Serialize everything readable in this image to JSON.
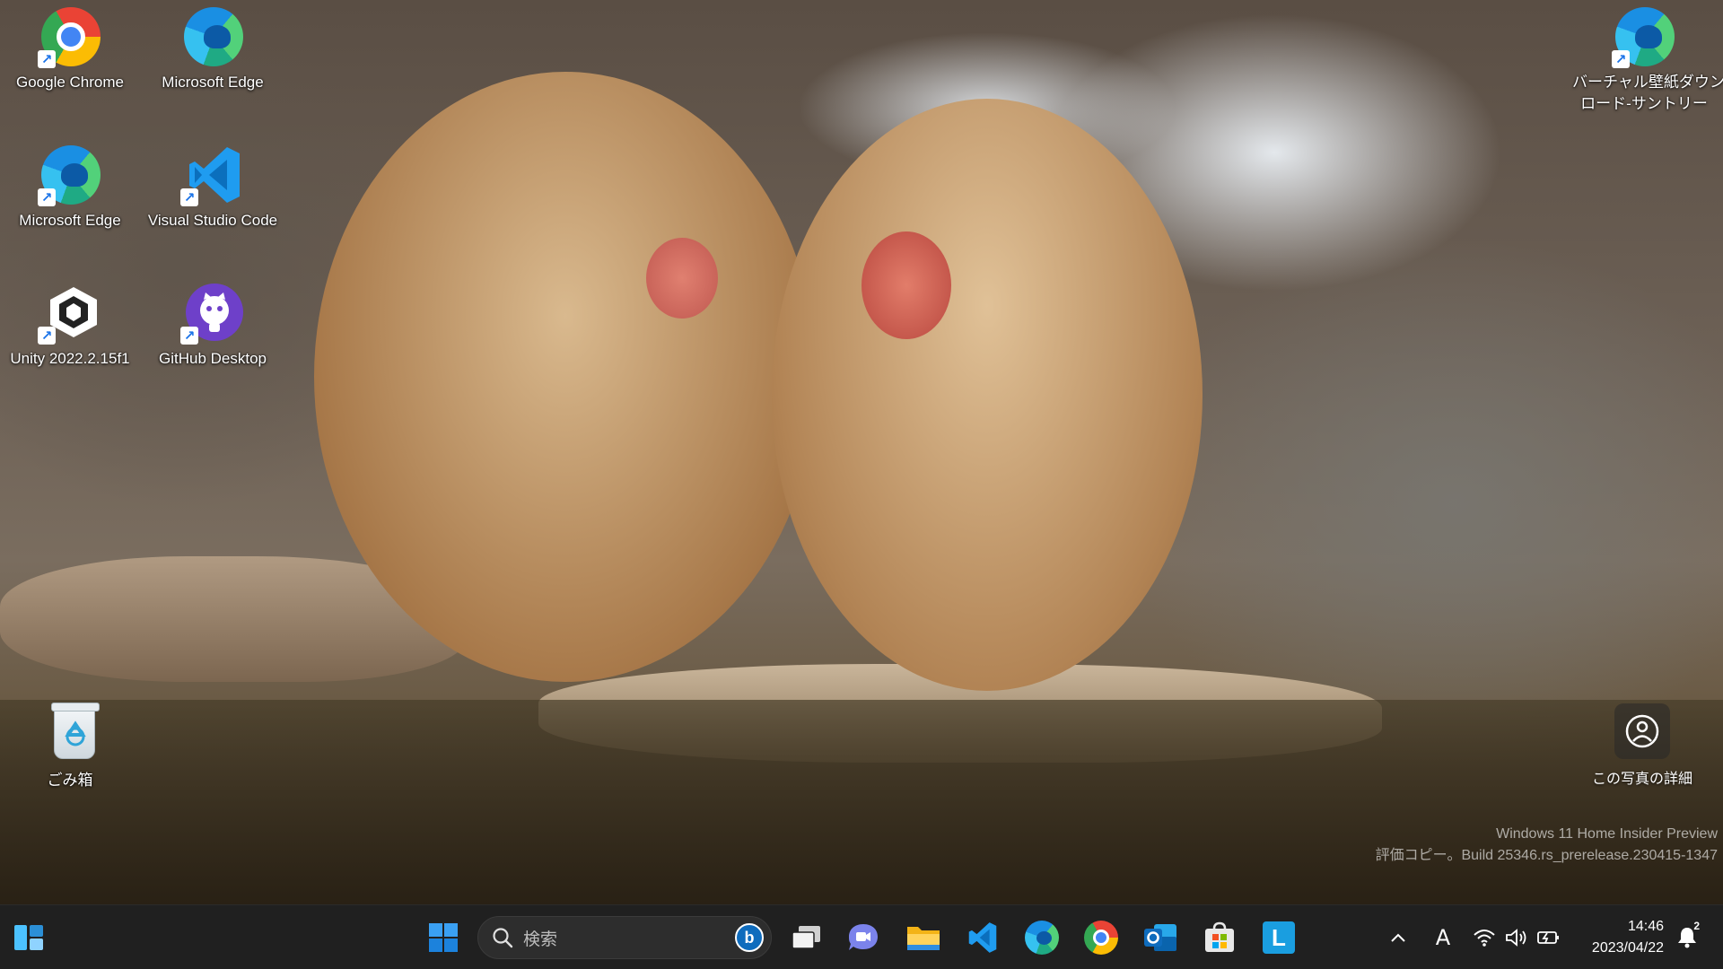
{
  "desktop": {
    "icons": [
      {
        "label": "Google Chrome",
        "icon": "chrome-icon"
      },
      {
        "label": "Microsoft Edge",
        "icon": "edge-icon"
      },
      {
        "label": "Microsoft Edge",
        "icon": "edge-icon"
      },
      {
        "label": "Visual Studio Code",
        "icon": "vscode-icon"
      },
      {
        "label": "Unity 2022.2.15f1",
        "icon": "unity-icon"
      },
      {
        "label": "GitHub Desktop",
        "icon": "github-desktop-icon"
      },
      {
        "label": "ごみ箱",
        "icon": "recycle-bin-icon"
      }
    ],
    "right_icon": {
      "label_line1": "バーチャル壁紙ダウン",
      "label_line2": "ロード-サントリー",
      "icon": "edge-icon"
    },
    "photo_details": {
      "label": "この写真の詳細",
      "icon": "photo-info-icon"
    },
    "watermark": {
      "line1": "Windows 11 Home Insider Preview",
      "line2": "評価コピー。Build 25346.rs_prerelease.230415-1347"
    }
  },
  "taskbar": {
    "widgets_icon": "widgets-icon",
    "start_icon": "windows-start-icon",
    "search": {
      "placeholder": "検索",
      "icon": "search-icon",
      "bing_icon": "bing-icon"
    },
    "pinned": [
      {
        "name": "task-view",
        "icon": "task-view-icon"
      },
      {
        "name": "chat",
        "icon": "teams-chat-icon"
      },
      {
        "name": "file-explorer",
        "icon": "folder-icon"
      },
      {
        "name": "vscode",
        "icon": "vscode-icon"
      },
      {
        "name": "edge",
        "icon": "edge-icon"
      },
      {
        "name": "chrome",
        "icon": "chrome-icon"
      },
      {
        "name": "outlook",
        "icon": "outlook-icon"
      },
      {
        "name": "store",
        "icon": "store-icon"
      },
      {
        "name": "l-app",
        "icon": "l-app-icon",
        "letter": "L"
      }
    ],
    "tray": {
      "ime_label": "A",
      "time": "14:46",
      "date": "2023/04/22",
      "notification_count": "2"
    }
  },
  "colors": {
    "taskbar_bg": "#202020",
    "accent_blue": "#0078d4"
  }
}
